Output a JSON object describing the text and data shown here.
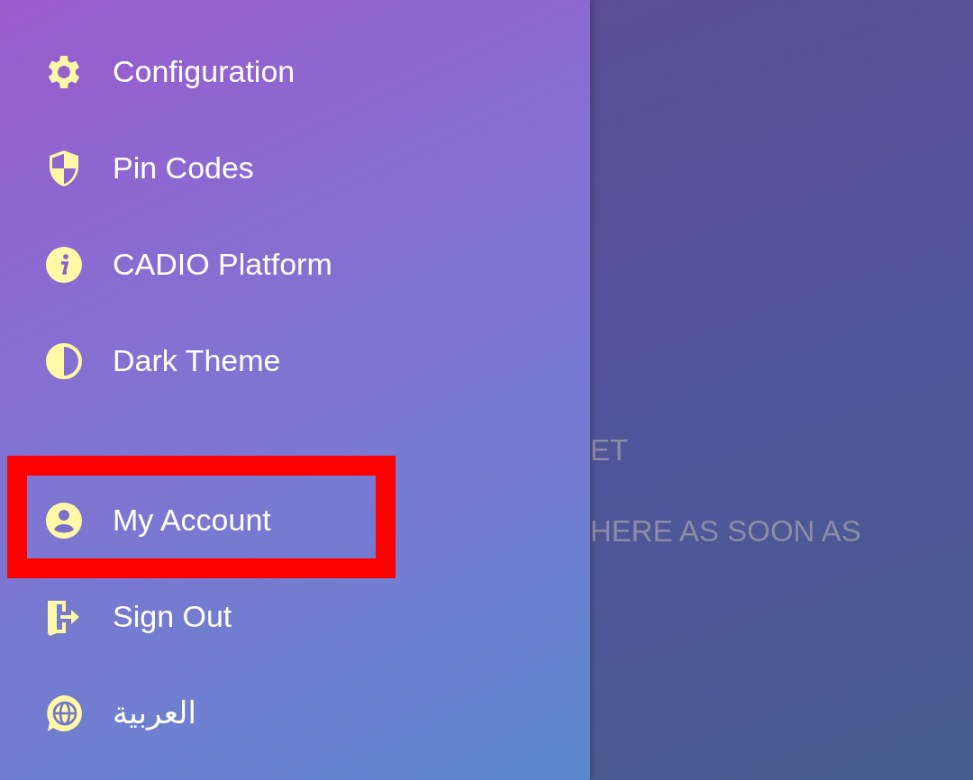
{
  "drawer": {
    "groups": [
      {
        "items": [
          {
            "kind": "gear",
            "label": "Configuration",
            "highlighted": false
          },
          {
            "kind": "shield",
            "label": "Pin Codes",
            "highlighted": false
          },
          {
            "kind": "info",
            "label": "CADIO Platform",
            "highlighted": false
          },
          {
            "kind": "contrast",
            "label": "Dark Theme",
            "highlighted": false
          }
        ]
      },
      {
        "items": [
          {
            "kind": "account",
            "label": "My Account",
            "highlighted": true
          },
          {
            "kind": "signout",
            "label": "Sign Out",
            "highlighted": false
          },
          {
            "kind": "language",
            "label": "العربية",
            "highlighted": false
          }
        ]
      }
    ]
  },
  "background_content": {
    "texts": [
      "ET",
      "HERE AS SOON AS"
    ]
  }
}
